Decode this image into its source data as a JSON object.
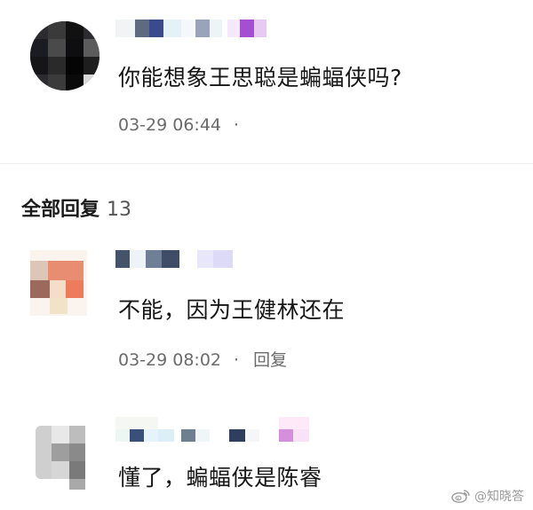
{
  "post": {
    "author": "",
    "text": "你能想象王思聪是蝙蝠侠吗?",
    "time": "03-29 06:44",
    "meta_dot": "·"
  },
  "replies_header": {
    "label": "全部回复",
    "count": "13"
  },
  "replies": [
    {
      "author": "",
      "text": "不能，因为王健林还在",
      "time": "03-29 08:02",
      "meta_dot": "·",
      "reply_label": "回复"
    },
    {
      "author": "",
      "text": "懂了，蝙蝠侠是陈睿"
    }
  ],
  "watermark": {
    "text": "@知晓答",
    "icon": "weibo-logo-icon"
  },
  "colors": {
    "text_primary": "#161616",
    "text_secondary": "#6b6b6b",
    "divider": "#ededed",
    "background": "#ffffff"
  }
}
